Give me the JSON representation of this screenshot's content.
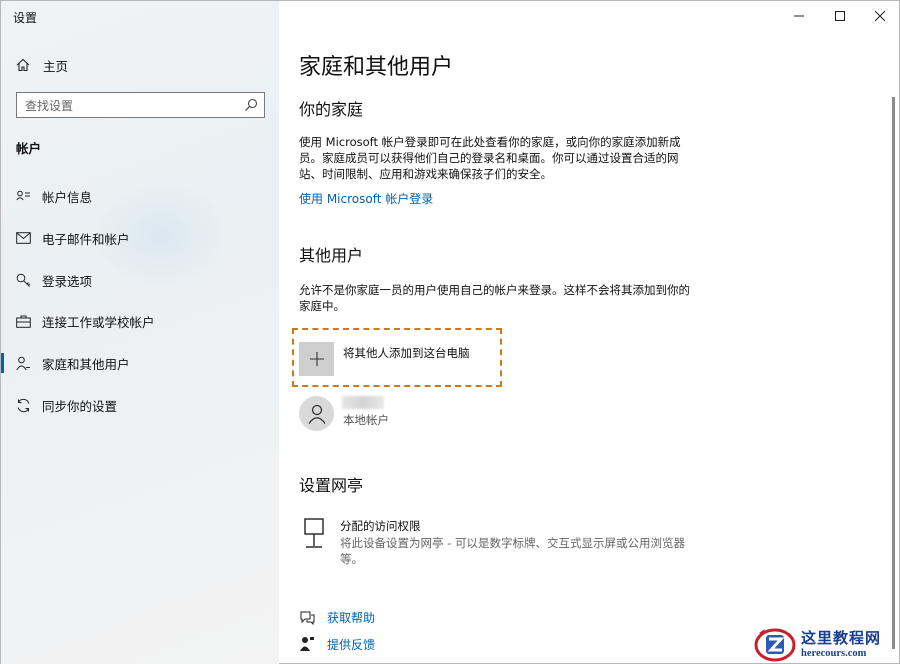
{
  "window": {
    "title": "设置"
  },
  "sidebar": {
    "home_label": "主页",
    "search_placeholder": "查找设置",
    "section": "帐户",
    "items": [
      {
        "label": "帐户信息",
        "icon": "person-card-icon"
      },
      {
        "label": "电子邮件和帐户",
        "icon": "mail-icon"
      },
      {
        "label": "登录选项",
        "icon": "key-icon"
      },
      {
        "label": "连接工作或学校帐户",
        "icon": "briefcase-icon"
      },
      {
        "label": "家庭和其他用户",
        "icon": "people-icon",
        "active": true
      },
      {
        "label": "同步你的设置",
        "icon": "sync-icon"
      }
    ]
  },
  "main": {
    "title": "家庭和其他用户",
    "family": {
      "heading": "你的家庭",
      "description": "使用 Microsoft 帐户登录即可在此处查看你的家庭，或向你的家庭添加新成员。家庭成员可以获得他们自己的登录名和桌面。你可以通过设置合适的网站、时间限制、应用和游戏来确保孩子们的安全。",
      "link": "使用 Microsoft 帐户登录"
    },
    "other_users": {
      "heading": "其他用户",
      "description": "允许不是你家庭一员的用户使用自己的帐户来登录。这样不会将其添加到你的家庭中。",
      "add_label": "将其他人添加到这台电脑",
      "user_type": "本地帐户"
    },
    "kiosk": {
      "heading": "设置网亭",
      "title": "分配的访问权限",
      "description": "将此设备设置为网亭 - 可以是数字标牌、交互式显示屏或公用浏览器等。"
    },
    "help": {
      "get_help": "获取帮助",
      "feedback": "提供反馈"
    }
  },
  "watermark": {
    "cn": "这里教程网",
    "en": "herecours.com"
  },
  "colors": {
    "accent": "#0063b1",
    "highlight_dash": "#c97a1b"
  }
}
